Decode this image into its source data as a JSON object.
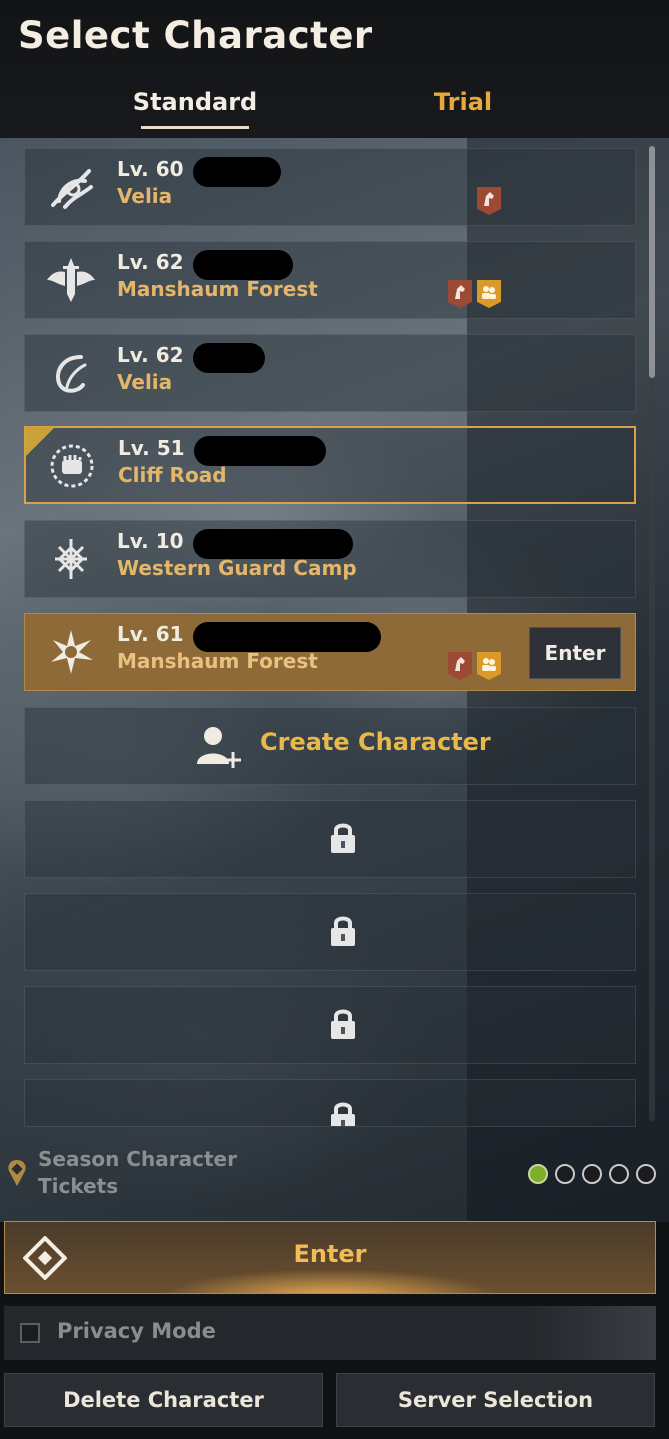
{
  "header": {
    "title": "Select Character",
    "tabs": [
      {
        "label": "Standard",
        "active": true
      },
      {
        "label": "Trial",
        "active": false
      }
    ]
  },
  "characters": [
    {
      "level": "Lv. 60",
      "location": "Velia",
      "class_icon": "flame-swirl-icon",
      "badges": [
        "horse-badge-icon"
      ]
    },
    {
      "level": "Lv. 62",
      "location": "Manshaum Forest",
      "class_icon": "winged-sword-icon",
      "badges": [
        "horse-badge-icon",
        "party-badge-icon"
      ]
    },
    {
      "level": "Lv. 62",
      "location": "Velia",
      "class_icon": "crescent-swirl-icon",
      "badges": []
    },
    {
      "level": "Lv. 51",
      "location": "Cliff Road",
      "class_icon": "fist-emblem-icon",
      "badges": [],
      "outlined": true
    },
    {
      "level": "Lv. 10",
      "location": "Western Guard Camp",
      "class_icon": "rune-knot-icon",
      "badges": []
    },
    {
      "level": "Lv. 61",
      "location": "Manshaum Forest",
      "class_icon": "spiked-star-icon",
      "badges": [
        "horse-badge-icon",
        "party-badge-icon"
      ],
      "selected": true,
      "enter_label": "Enter"
    }
  ],
  "create_character": {
    "label": "Create Character",
    "icon": "add-user-icon"
  },
  "locked_slots": 4,
  "season": {
    "label": "Season Character Tickets",
    "tickets_filled": 1,
    "tickets_total": 5
  },
  "enter_button": {
    "label": "Enter",
    "icon": "diamond-logo-icon"
  },
  "privacy_mode": {
    "label": "Privacy Mode",
    "checked": false
  },
  "footer": {
    "delete_label": "Delete Character",
    "server_label": "Server Selection"
  },
  "colors": {
    "accent_gold": "#eab849",
    "location_text": "#e4b66a",
    "selected_row": "#8d6a38",
    "horse_badge": "#9c4a34",
    "party_badge": "#d99a2a"
  }
}
